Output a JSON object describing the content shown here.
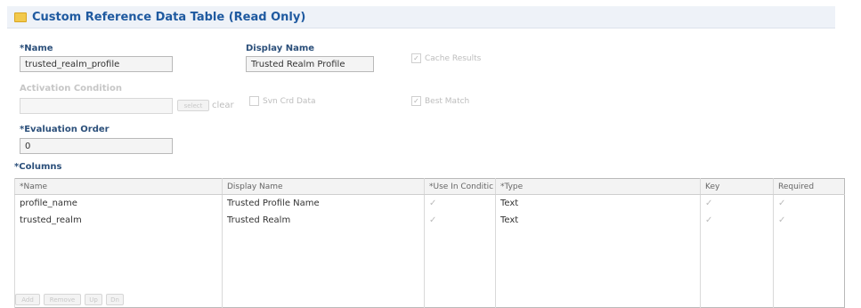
{
  "header": {
    "title": "Custom Reference Data Table (Read Only)",
    "icon": "folder-icon",
    "icon_color": "#f2c94c",
    "title_color": "#1f5aa0"
  },
  "form": {
    "name_label": "*Name",
    "name_value": "trusted_realm_profile",
    "display_name_label": "Display Name",
    "display_name_value": "Trusted Realm Profile",
    "cache_results_label": "Cache Results",
    "cache_results_checked": true,
    "activation_condition_label": "Activation Condition",
    "activation_condition_value": "",
    "select_label": "select",
    "clear_label": "clear",
    "svn_crd_label": "Svn Crd Data",
    "svn_crd_checked": false,
    "best_match_label": "Best Match",
    "best_match_checked": true,
    "evaluation_order_label": "*Evaluation Order",
    "evaluation_order_value": "0",
    "columns_label": "*Columns"
  },
  "table": {
    "headers": [
      "*Name",
      "Display Name",
      "*Use In Conditic",
      "*Type",
      "Key",
      "Required"
    ],
    "rows": [
      {
        "name": "profile_name",
        "display": "Trusted Profile Name",
        "use": "✓",
        "type": "Text",
        "key": "✓",
        "required": "✓"
      },
      {
        "name": "trusted_realm",
        "display": "Trusted Realm",
        "use": "✓",
        "type": "Text",
        "key": "✓",
        "required": "✓"
      }
    ]
  },
  "buttons": {
    "add": "Add",
    "remove": "Remove",
    "up": "Up",
    "down": "Dn"
  },
  "check_mark": "✓"
}
